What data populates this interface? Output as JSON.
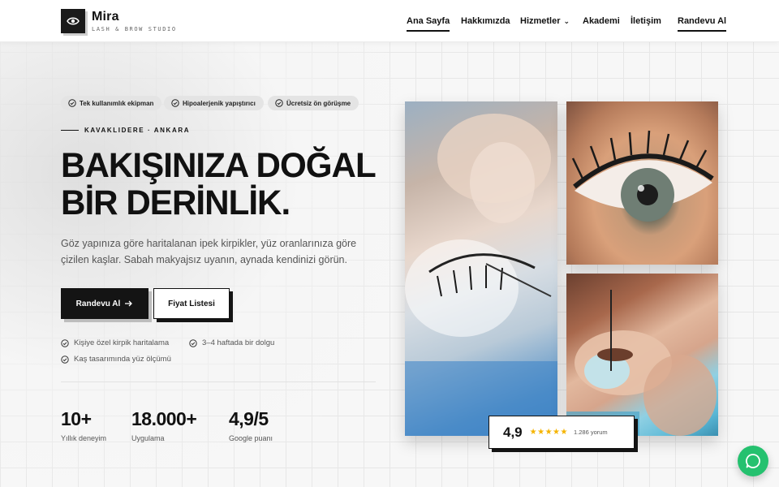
{
  "brand": {
    "name": "Mira",
    "tagline": "LASH & BROW STUDIO",
    "logo_icon": "eye-icon"
  },
  "nav": {
    "items": [
      {
        "label": "Ana Sayfa",
        "active": true
      },
      {
        "label": "Hakkımızda"
      },
      {
        "label": "Hizmetler",
        "has_dropdown": true
      },
      {
        "label": "Akademi"
      },
      {
        "label": "İletişim"
      }
    ],
    "cta": "Randevu Al"
  },
  "badges": [
    "Tek kullanımlık ekipman",
    "Hipoalerjenik yapıştırıcı",
    "Ücretsiz ön görüşme"
  ],
  "hero": {
    "eyebrow": "KAVAKLIDERE · ANKARA",
    "title_line1": "BAKIŞINIZA DOĞAL",
    "title_line2": "BİR DERİNLİK.",
    "lead": "Göz yapınıza göre haritalanan ipek kirpikler, yüz oranlarınıza göre çizilen kaşlar. Sabah makyajsız uyanın, aynada kendinizi görün.",
    "primary_button": "Randevu Al",
    "secondary_button": "Fiyat Listesi"
  },
  "features": [
    "Kişiye özel kirpik haritalama",
    "3–4 haftada bir dolgu",
    "Kaş tasarımında yüz ölçümü"
  ],
  "stats": [
    {
      "value": "10+",
      "label": "Yıllık deneyim"
    },
    {
      "value": "18.000+",
      "label": "Uygulama"
    },
    {
      "value": "4,9/5",
      "label": "Google puanı"
    }
  ],
  "rating": {
    "score": "4,9",
    "stars": "★★★★★",
    "reviews": "1.286 yorum"
  },
  "colors": {
    "accent": "#111111",
    "star": "#f5b400",
    "whatsapp": "#25c16f"
  },
  "floating_button_icon": "whatsapp-icon"
}
